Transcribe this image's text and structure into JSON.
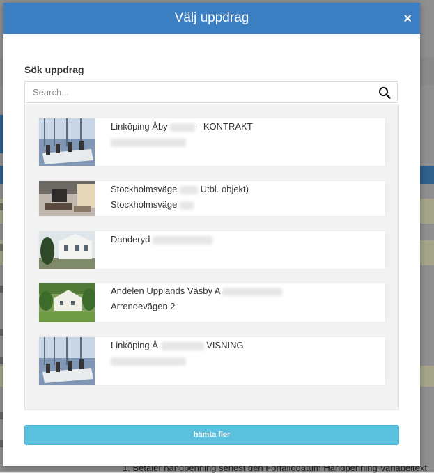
{
  "modal": {
    "title": "Välj uppdrag",
    "close_label": "×"
  },
  "search": {
    "label": "Sök uppdrag",
    "placeholder": "Search...",
    "value": ""
  },
  "results": [
    {
      "line1_start": "Linköping Åby",
      "line1_end": "- KONTRAKT",
      "line2": "",
      "thumb": "conservatory-dining-photo"
    },
    {
      "line1_start": "Stockholmsväge",
      "line1_end": "Utbl. objekt)",
      "line2": "Stockholmsväge",
      "thumb": "living-room-photo"
    },
    {
      "line1_start": "Danderyd",
      "line1_end": "",
      "line2": "",
      "thumb": "white-house-photo"
    },
    {
      "line1_start": "Andelen Upplands Väsby A",
      "line1_end": "",
      "line2": "Arrendevägen 2",
      "thumb": "garden-house-photo"
    },
    {
      "line1_start": "Linköping Å",
      "line1_end": "VISNING",
      "line2": "",
      "thumb": "conservatory-dining-photo"
    }
  ],
  "fetch_more_label": "hämta fler",
  "background": {
    "footer_text": "1. Betaler handpenning senest den   Förfallodatum Handpenning Variabeltext"
  },
  "colors": {
    "header": "#3d7fc3",
    "button": "#5bc0de"
  }
}
